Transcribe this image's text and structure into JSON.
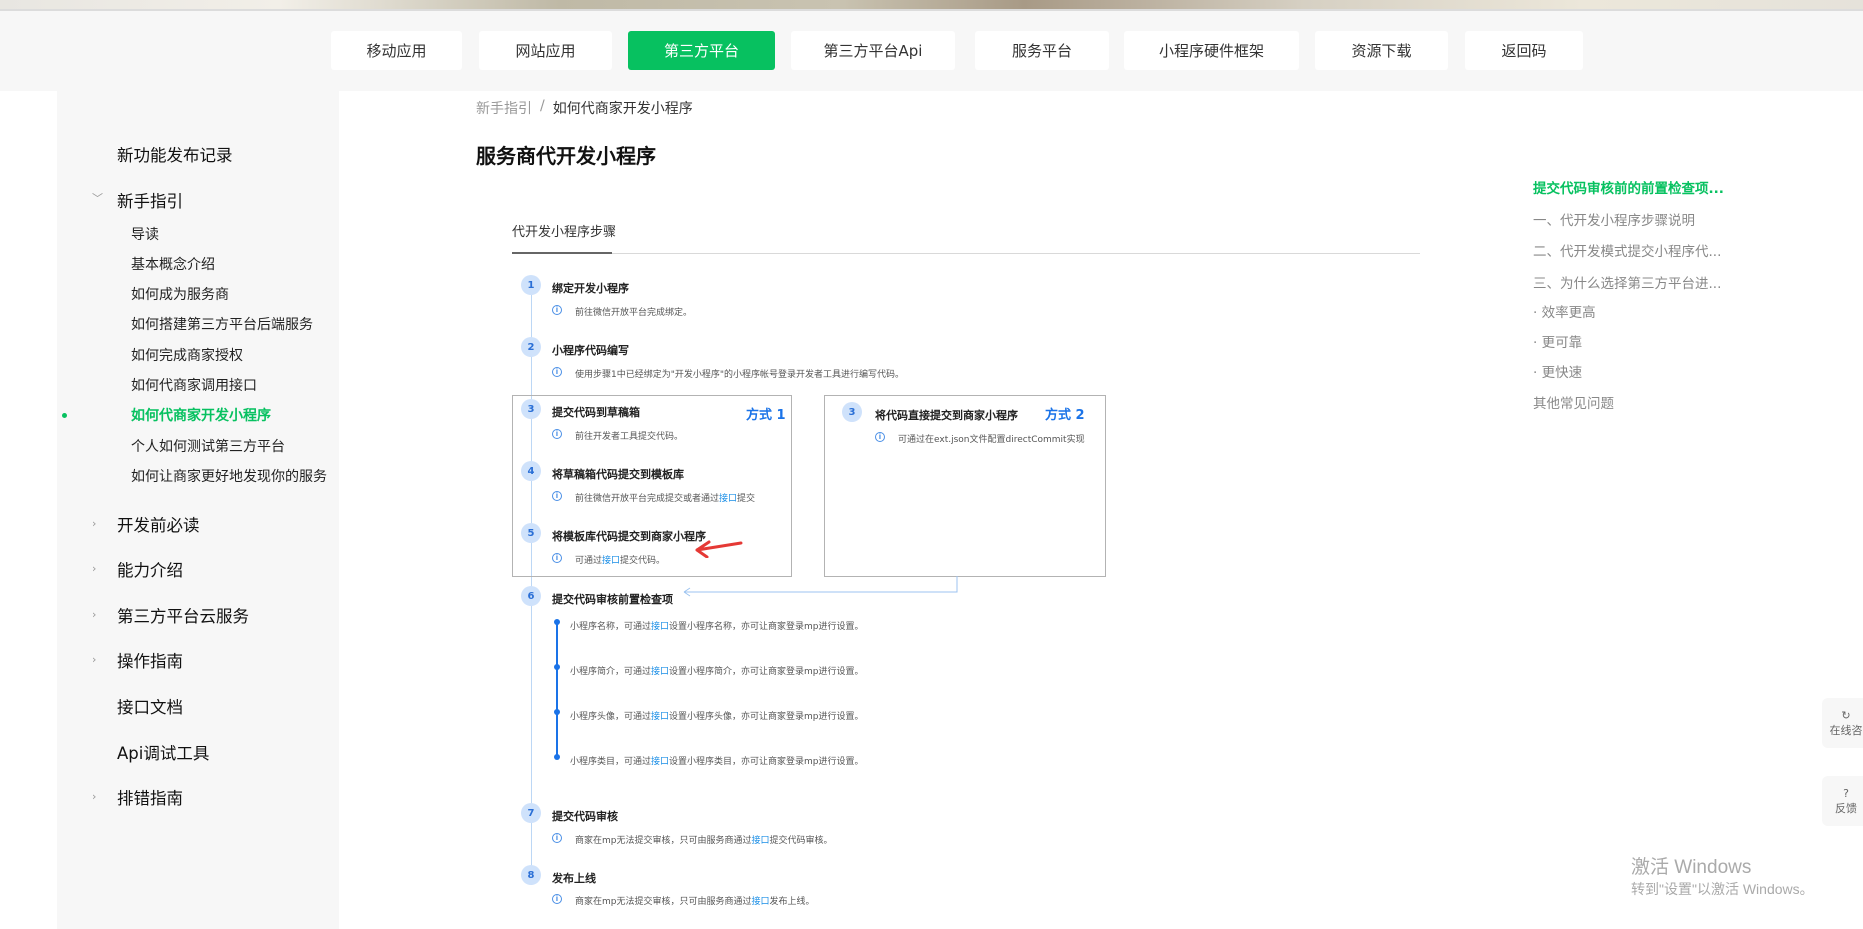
{
  "topnav": {
    "items": [
      {
        "label": "移动应用",
        "active": false
      },
      {
        "label": "网站应用",
        "active": false
      },
      {
        "label": "第三方平台",
        "active": true
      },
      {
        "label": "第三方平台Api",
        "active": false
      },
      {
        "label": "服务平台",
        "active": false
      },
      {
        "label": "小程序硬件框架",
        "active": false
      },
      {
        "label": "资源下载",
        "active": false
      },
      {
        "label": "返回码",
        "active": false
      }
    ]
  },
  "sidebar": {
    "release_notes": "新功能发布记录",
    "guide": "新手指引",
    "guide_items": [
      {
        "label": "导读",
        "active": false
      },
      {
        "label": "基本概念介绍",
        "active": false
      },
      {
        "label": "如何成为服务商",
        "active": false
      },
      {
        "label": "如何搭建第三方平台后端服务",
        "active": false
      },
      {
        "label": "如何完成商家授权",
        "active": false
      },
      {
        "label": "如何代商家调用接口",
        "active": false
      },
      {
        "label": "如何代商家开发小程序",
        "active": true
      },
      {
        "label": "个人如何测试第三方平台",
        "active": false
      },
      {
        "label": "如何让商家更好地发现你的服务",
        "active": false
      }
    ],
    "dev_read": "开发前必读",
    "capability": "能力介绍",
    "cloud": "第三方平台云服务",
    "ops": "操作指南",
    "api_docs": "接口文档",
    "api_debug": "Api调试工具",
    "troubleshoot": "排错指南"
  },
  "breadcrumb": {
    "parent": "新手指引",
    "sep": "/",
    "current": "如何代商家开发小程序"
  },
  "page_title": "服务商代开发小程序",
  "toc": {
    "items": [
      {
        "label": "提交代码审核前的前置检查项...",
        "active": true
      },
      {
        "label": "一、代开发小程序步骤说明",
        "active": false
      },
      {
        "label": "二、代开发模式提交小程序代...",
        "active": false
      },
      {
        "label": "三、为什么选择第三方平台进...",
        "active": false
      },
      {
        "label": "· 效率更高",
        "active": false
      },
      {
        "label": "· 更可靠",
        "active": false
      },
      {
        "label": "· 更快速",
        "active": false
      },
      {
        "label": "其他常见问题",
        "active": false
      }
    ]
  },
  "figure": {
    "tab": "代开发小程序步骤",
    "info_icon": "i",
    "steps": {
      "s1": {
        "num": "1",
        "title": "绑定开发小程序",
        "desc": "前往微信开放平台完成绑定。"
      },
      "s2": {
        "num": "2",
        "title": "小程序代码编写",
        "desc": "使用步骤1中已经绑定为\"开发小程序\"的小程序帐号登录开发者工具进行编写代码。"
      },
      "s3": {
        "num": "3",
        "title": "提交代码到草稿箱",
        "desc": "前往开发者工具提交代码。"
      },
      "s4": {
        "num": "4",
        "title": "将草稿箱代码提交到模板库",
        "desc_a": "前往微信开放平台完成提交或者通过",
        "desc_link": "接口",
        "desc_b": "提交"
      },
      "s5": {
        "num": "5",
        "title": "将模板库代码提交到商家小程序",
        "desc_a": "可通过",
        "desc_link": "接口",
        "desc_b": "提交代码。"
      },
      "s3b": {
        "num": "3",
        "title": "将代码直接提交到商家小程序",
        "desc": "可通过在ext.json文件配置directCommit实现"
      },
      "s6": {
        "num": "6",
        "title": "提交代码审核前置检查项"
      },
      "s7": {
        "num": "7",
        "title": "提交代码审核",
        "desc_a": "商家在mp无法提交审核，只可由服务商通过",
        "desc_link": "接口",
        "desc_b": "提交代码审核。"
      },
      "s8": {
        "num": "8",
        "title": "发布上线",
        "desc_a": "商家在mp无法提交审核，只可由服务商通过",
        "desc_link": "接口",
        "desc_b": "发布上线。"
      }
    },
    "mode1": "方式 1",
    "mode2": "方式 2",
    "checks": [
      {
        "a": "小程序名称，可通过",
        "link": "接口",
        "b": "设置小程序名称，亦可让商家登录mp进行设置。"
      },
      {
        "a": "小程序简介，可通过",
        "link": "接口",
        "b": "设置小程序简介，亦可让商家登录mp进行设置。"
      },
      {
        "a": "小程序头像，可通过",
        "link": "接口",
        "b": "设置小程序头像，亦可让商家登录mp进行设置。"
      },
      {
        "a": "小程序类目，可通过",
        "link": "接口",
        "b": "设置小程序类目，亦可让商家登录mp进行设置。"
      }
    ]
  },
  "float": {
    "consult": "在线咨",
    "consult_icon": "↻",
    "feedback": "反馈",
    "feedback_icon": "?"
  },
  "watermark": {
    "line1": "激活 Windows",
    "line2": "转到\"设置\"以激活 Windows。"
  },
  "colors": {
    "accent": "#07c160",
    "link": "#1a8ee6",
    "step_blue": "#1a73e8"
  }
}
